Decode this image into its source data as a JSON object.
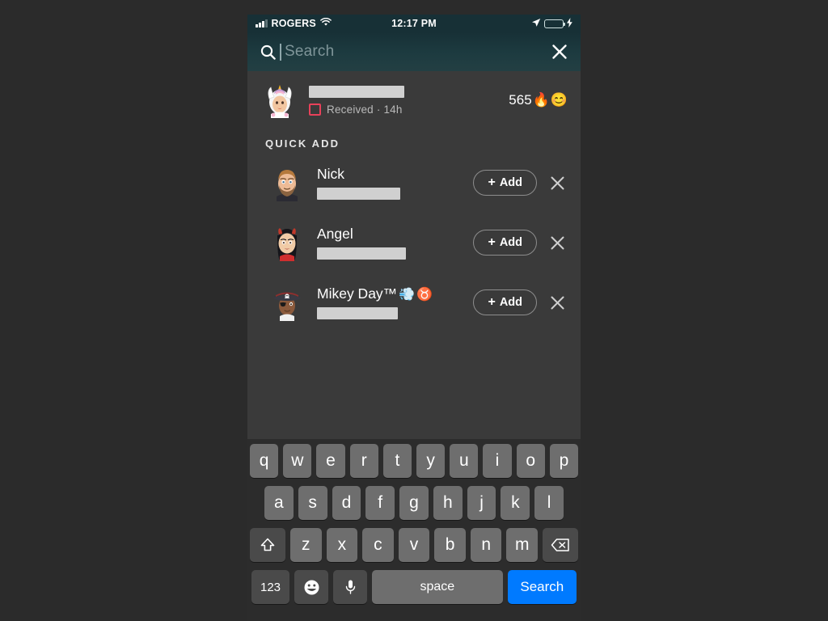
{
  "status_bar": {
    "carrier": "ROGERS",
    "time": "12:17 PM",
    "signal_bars_filled": 3,
    "wifi_icon": "wifi-icon",
    "location_icon": "location-arrow-icon",
    "battery_icon": "battery-full-icon",
    "charging_icon": "lightning-bolt-icon",
    "battery_color": "#4cd964"
  },
  "search": {
    "icon": "search-icon",
    "placeholder": "Search",
    "value": "",
    "close_icon": "close-icon"
  },
  "recent_friend": {
    "avatar": "unicorn-bitmoji-avatar",
    "name_redacted": true,
    "status_icon": "received-snap-square",
    "status_icon_color": "#e8415a",
    "status_text": "Received · 14h",
    "score": "565",
    "streak_emoji": "🔥",
    "face_emoji": "😊"
  },
  "quick_add": {
    "title": "QUICK ADD",
    "add_label": "Add",
    "add_plus": "+",
    "dismiss_icon": "close-icon",
    "items": [
      {
        "avatar": "bearded-man-bitmoji-avatar",
        "name": "Nick",
        "username_redacted": true,
        "badges": []
      },
      {
        "avatar": "devil-girl-bitmoji-avatar",
        "name": "Angel",
        "username_redacted": true,
        "badges": []
      },
      {
        "avatar": "pirate-bitmoji-avatar",
        "name": "Mikey Day™",
        "username_redacted": true,
        "badges": [
          "💨",
          "♉"
        ]
      }
    ]
  },
  "keyboard": {
    "row1": [
      "q",
      "w",
      "e",
      "r",
      "t",
      "y",
      "u",
      "i",
      "o",
      "p"
    ],
    "row2": [
      "a",
      "s",
      "d",
      "f",
      "g",
      "h",
      "j",
      "k",
      "l"
    ],
    "row3_letters": [
      "z",
      "x",
      "c",
      "v",
      "b",
      "n",
      "m"
    ],
    "shift_icon": "shift-arrow-icon",
    "backspace_icon": "backspace-icon",
    "numbers_label": "123",
    "emoji_icon": "emoji-smiley-icon",
    "mic_icon": "microphone-icon",
    "space_label": "space",
    "search_label": "Search",
    "search_key_color": "#007aff"
  }
}
